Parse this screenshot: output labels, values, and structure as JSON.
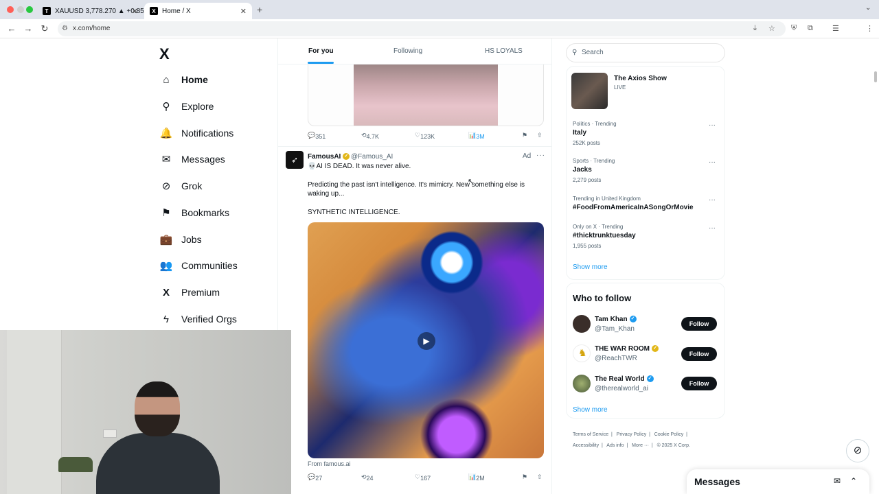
{
  "browser": {
    "tabs": [
      {
        "favicon": "T",
        "title": "XAUUSD 3,778.270 ▲ +0.85%"
      },
      {
        "favicon": "X",
        "title": "Home / X"
      }
    ],
    "new_tab": "+",
    "url": "x.com/home"
  },
  "sidebar": {
    "logo": "X",
    "items": [
      {
        "icon": "home-icon",
        "glyph": "⌂",
        "label": "Home"
      },
      {
        "icon": "explore-icon",
        "glyph": "⚲",
        "label": "Explore"
      },
      {
        "icon": "bell-icon",
        "glyph": "🔔",
        "label": "Notifications"
      },
      {
        "icon": "mail-icon",
        "glyph": "✉",
        "label": "Messages"
      },
      {
        "icon": "grok-icon",
        "glyph": "⊘",
        "label": "Grok"
      },
      {
        "icon": "bookmark-icon",
        "glyph": "⚑",
        "label": "Bookmarks"
      },
      {
        "icon": "briefcase-icon",
        "glyph": "💼",
        "label": "Jobs"
      },
      {
        "icon": "communities-icon",
        "glyph": "👥",
        "label": "Communities"
      },
      {
        "icon": "x-premium-icon",
        "glyph": "X",
        "label": "Premium"
      },
      {
        "icon": "lightning-icon",
        "glyph": "ϟ",
        "label": "Verified Orgs"
      }
    ]
  },
  "feed": {
    "tabs": [
      "For you",
      "Following",
      "HS LOYALS"
    ],
    "tweet1_actions": {
      "replies": "351",
      "reposts": "4.7K",
      "likes": "123K",
      "views": "3M"
    },
    "tweet2": {
      "name": "FamousAI",
      "handle": "@Famous_AI",
      "ad_label": "Ad",
      "line1": "💀AI IS DEAD. It was never alive.",
      "line2": "Predicting the past isn't intelligence. It's mimicry. New something else is waking up...",
      "line3": "SYNTHETIC INTELLIGENCE.",
      "from": "From famous.ai",
      "actions": {
        "replies": "27",
        "reposts": "24",
        "likes": "167",
        "views": "2M"
      }
    }
  },
  "right": {
    "search_placeholder": "Search",
    "live": {
      "title": "The Axios Show",
      "status": "LIVE"
    },
    "trends": [
      {
        "meta": "Politics · Trending",
        "title": "Italy",
        "count": "252K posts"
      },
      {
        "meta": "Sports · Trending",
        "title": "Jacks",
        "count": "2,279 posts"
      },
      {
        "meta": "Trending in United Kingdom",
        "title": "#FoodFromAmericaInASongOrMovie",
        "count": ""
      },
      {
        "meta": "Only on X · Trending",
        "title": "#thicktrunktuesday",
        "count": "1,955 posts"
      }
    ],
    "show_more": "Show more",
    "who_to_follow": {
      "title": "Who to follow",
      "accounts": [
        {
          "name": "Tam Khan",
          "handle": "@Tam_Khan",
          "badge": "blue",
          "avatar_color": "#3a2e2a"
        },
        {
          "name": "THE WAR ROOM",
          "handle": "@ReachTWR",
          "badge": "gold",
          "avatar_color": "#d4a30a"
        },
        {
          "name": "The Real World",
          "handle": "@therealworld_ai",
          "badge": "blue",
          "avatar_color": "#6b7a4a"
        }
      ],
      "follow_label": "Follow",
      "show_more": "Show more"
    },
    "footer": {
      "line1": [
        "Terms of Service",
        "Privacy Policy",
        "Cookie Policy"
      ],
      "line2": [
        "Accessibility",
        "Ads info",
        "More ···",
        "© 2025 X Corp."
      ]
    }
  },
  "messages_drawer": {
    "title": "Messages"
  },
  "colors": {
    "accent": "#1d9bf0",
    "text": "#0f1419",
    "muted": "#536471"
  }
}
